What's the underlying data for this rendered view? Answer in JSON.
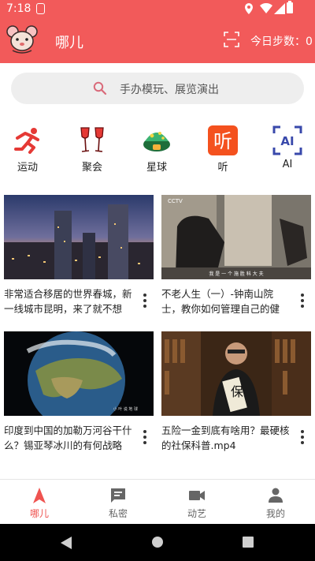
{
  "status": {
    "time": "7:18"
  },
  "header": {
    "title": "哪儿",
    "steps_label": "今日步数：0"
  },
  "search": {
    "placeholder": "手办模玩、展览演出"
  },
  "categories": [
    {
      "label": "运动",
      "icon": "running-icon"
    },
    {
      "label": "聚会",
      "icon": "wine-glasses-icon"
    },
    {
      "label": "星球",
      "icon": "mushroom-planet-icon"
    },
    {
      "label": "听",
      "icon": "listen-icon"
    },
    {
      "label": "AI",
      "icon": "ai-scan-icon"
    }
  ],
  "videos": [
    {
      "title": "非常适合移居的世界春城，新一线城市昆明，来了就不想离...",
      "thumb_caption": ""
    },
    {
      "title": "不老人生（一）-钟南山院士，教你如何管理自己的健康，出...",
      "thumb_caption": "我 是 一 个 施 胜 科 大 夫"
    },
    {
      "title": "印度到中国的加勒万河谷干什么？锡亚琴冰川的有何战略价...",
      "thumb_caption": ""
    },
    {
      "title": "五险一金到底有啥用？最硬核的社保科普.mp4",
      "thumb_caption": "保"
    }
  ],
  "bottom_nav": [
    {
      "label": "哪儿",
      "icon": "navigation-arrow-icon",
      "active": true
    },
    {
      "label": "私密",
      "icon": "chat-message-icon",
      "active": false
    },
    {
      "label": "动艺",
      "icon": "video-camera-icon",
      "active": false
    },
    {
      "label": "我的",
      "icon": "person-icon",
      "active": false
    }
  ],
  "colors": {
    "primary": "#f25a5a",
    "active_tab": "#ef5350"
  }
}
